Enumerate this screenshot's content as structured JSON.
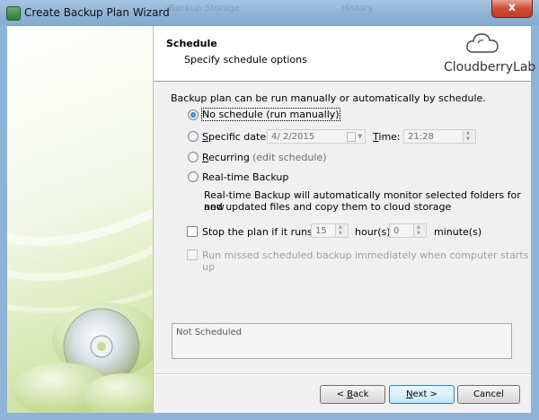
{
  "window": {
    "title": "Create Backup Plan Wizard",
    "ghost_titles": [
      "Backup Storage",
      "History"
    ],
    "close_glyph": "x"
  },
  "header": {
    "title": "Schedule",
    "subtitle": "Specify schedule options",
    "brand": "CloudberryLab"
  },
  "intro": "Backup plan can be run manually or automatically by schedule.",
  "options": {
    "selected": "no_schedule",
    "no_schedule": "No schedule (run manually)",
    "specific_date": "Specific date:",
    "date_value": "4/  2/2015",
    "time_label": "Time:",
    "time_value": "21:28",
    "recurring": "Recurring",
    "edit_schedule": "(edit schedule)",
    "realtime": "Real-time Backup",
    "realtime_desc_1": "Real-time Backup will automatically monitor selected folders for new",
    "realtime_desc_2": "and updated files and copy them to cloud storage"
  },
  "stop_plan": {
    "checked": false,
    "label": "Stop the plan if it runs for:",
    "hours_value": "15",
    "hours_label": "hour(s)",
    "minutes_value": "0",
    "minutes_label": "minute(s)"
  },
  "missed": {
    "checked": false,
    "enabled": false,
    "label": "Run missed scheduled backup immediately when computer starts up"
  },
  "status": {
    "text": "Not Scheduled"
  },
  "buttons": {
    "back": "< Back",
    "next": "Next >",
    "cancel": "Cancel"
  },
  "colors": {
    "titlebar": "#8fb3d6",
    "close_button": "#cf4d35",
    "sidebar_green": "#c6dc98",
    "disc_silver": "#d9e2e8"
  }
}
